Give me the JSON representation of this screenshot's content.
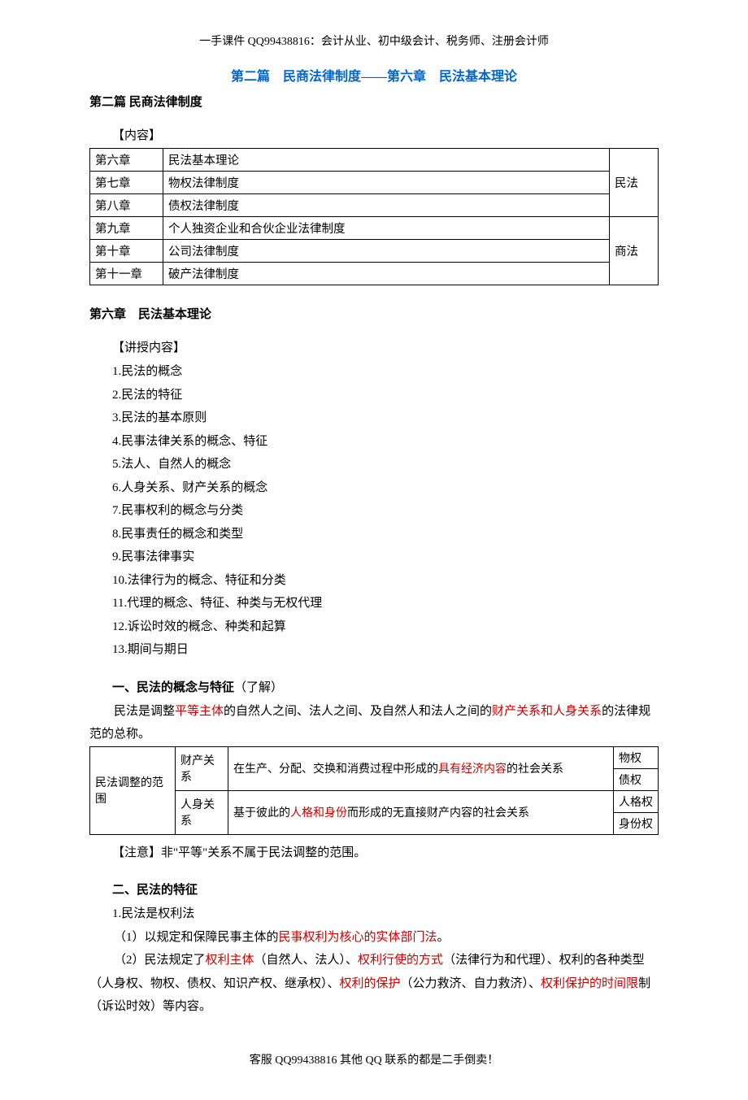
{
  "header": "一手课件 QQ99438816：会计从业、初中级会计、税务师、注册会计师",
  "title_blue": "第二篇　民商法律制度——第六章　民法基本理论",
  "section2_title": "第二篇 民商法律制度",
  "content_label": "【内容】",
  "table1": {
    "rows": [
      {
        "c1": "第六章",
        "c2": "民法基本理论"
      },
      {
        "c1": "第七章",
        "c2": "物权法律制度"
      },
      {
        "c1": "第八章",
        "c2": "债权法律制度"
      },
      {
        "c1": "第九章",
        "c2": "个人独资企业和合伙企业法律制度"
      },
      {
        "c1": "第十章",
        "c2": "公司法律制度"
      },
      {
        "c1": "第十一章",
        "c2": "破产法律制度"
      }
    ],
    "group1": "民法",
    "group2": "商法"
  },
  "chapter6_title": "第六章　民法基本理论",
  "lecture_label": "【讲授内容】",
  "lecture_items": [
    "1.民法的概念",
    "2.民法的特征",
    "3.民法的基本原则",
    "4.民事法律关系的概念、特征",
    "5.法人、自然人的概念",
    "6.人身关系、财产关系的概念",
    "7.民事权利的概念与分类",
    "8.民事责任的概念和类型",
    "9.民事法律事实",
    "10.法律行为的概念、特征和分类",
    "11.代理的概念、特征、种类与无权代理",
    "12.诉讼时效的概念、种类和起算",
    "13.期间与期日"
  ],
  "heading1": {
    "bold": "一、民法的概念与特征",
    "normal": "（了解）"
  },
  "para1": {
    "t1": "民法是调整",
    "r1": "平等主体",
    "t2": "的自然人之间、法人之间、及自然人和法人之间的",
    "r2": "财产关系和人身关系",
    "t3": "的法律规范的总称。"
  },
  "table2": {
    "scope": "民法调整的范围",
    "row1": {
      "rel": "财产关系",
      "desc_a": "在生产、分配、交换和消费过程中形成的",
      "desc_red": "具有经济内容",
      "desc_b": "的社会关系",
      "t1": "物权",
      "t2": "债权"
    },
    "row2": {
      "rel": "人身关系",
      "desc_a": "基于彼此的",
      "desc_red": "人格和身份",
      "desc_b": "而形成的无直接财产内容的社会关系",
      "t1": "人格权",
      "t2": "身份权"
    }
  },
  "note1": "【注意】非\"平等\"关系不属于民法调整的范围。",
  "heading2": "二、民法的特征",
  "sub1": "1.民法是权利法",
  "para2": {
    "t1": "（1）以规定和保障民事主体的",
    "r1": "民事权利为核心的实体部门法",
    "t2": "。"
  },
  "para3": {
    "t1": "（2）民法规定了",
    "r1": "权利主体",
    "t2": "（自然人、法人）、",
    "r2": "权利行使的方式",
    "t3": "（法律行为和代理）、权利的各种类型（人身权、物权、债权、知识产权、继承权）、",
    "r3": "权利的保护",
    "t4": "（公力救济、自力救济）、",
    "r4": "权利保护的时间限",
    "t5": "制（诉讼时效）等内容。"
  },
  "footer": "客服 QQ99438816 其他 QQ 联系的都是二手倒卖！"
}
